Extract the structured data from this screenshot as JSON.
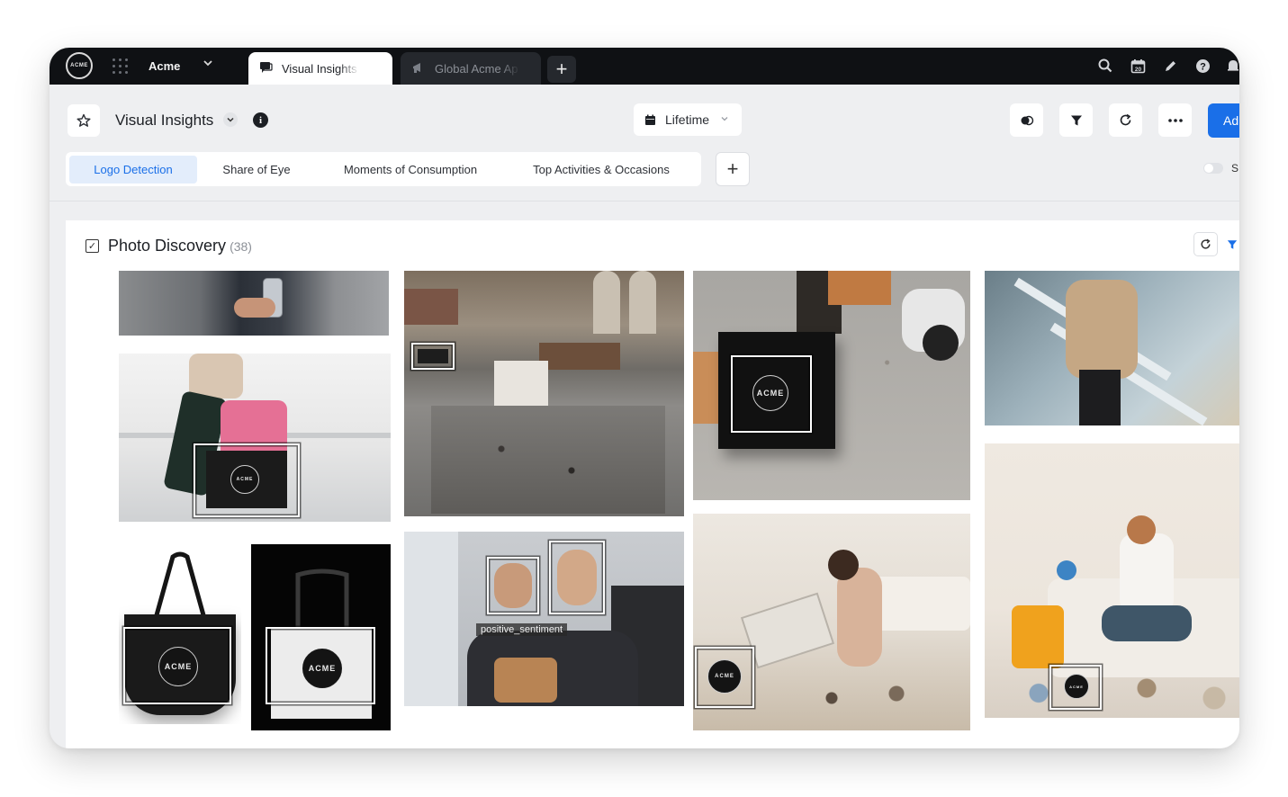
{
  "topbar": {
    "logo_text": "ACME",
    "brand": "Acme",
    "tabs": [
      {
        "label": "Visual Insights",
        "icon": "chat-bubble-icon"
      },
      {
        "label": "Global Acme Ap",
        "icon": "megaphone-icon"
      }
    ],
    "new_tab": "+",
    "icons": [
      "search-icon",
      "calendar-icon",
      "pencil-icon",
      "help-icon",
      "bell-icon"
    ],
    "calendar_day": "20"
  },
  "header": {
    "title": "Visual Insights",
    "date_range": "Lifetime",
    "add_button": "Ad",
    "accent": "#1a6fe8"
  },
  "subtabs": [
    {
      "label": "Logo Detection",
      "active": true
    },
    {
      "label": "Share of Eye",
      "active": false
    },
    {
      "label": "Moments of Consumption",
      "active": false
    },
    {
      "label": "Top Activities & Occasions",
      "active": false
    }
  ],
  "add_tab": "+",
  "toggle_label": "S",
  "panel": {
    "title": "Photo Discovery",
    "count": "(38)",
    "photos": [
      {
        "subject": "person holding phone"
      },
      {
        "subject": "woman with pink suitcase",
        "logo_text": "ACME"
      },
      {
        "subject": "black tote bag",
        "logo_text": "ACME"
      },
      {
        "subject": "white tote bag",
        "logo_text": "ACME"
      },
      {
        "subject": "busy train station hall"
      },
      {
        "subject": "friends on train",
        "tag": "positive_sentiment"
      },
      {
        "subject": "black shopping bag on pavement",
        "logo_text": "ACME"
      },
      {
        "subject": "woman packing suitcase",
        "logo_text": "ACME"
      },
      {
        "subject": "woman on escalator"
      },
      {
        "subject": "woman reading on sofa",
        "logo_text": "ACME"
      }
    ]
  }
}
